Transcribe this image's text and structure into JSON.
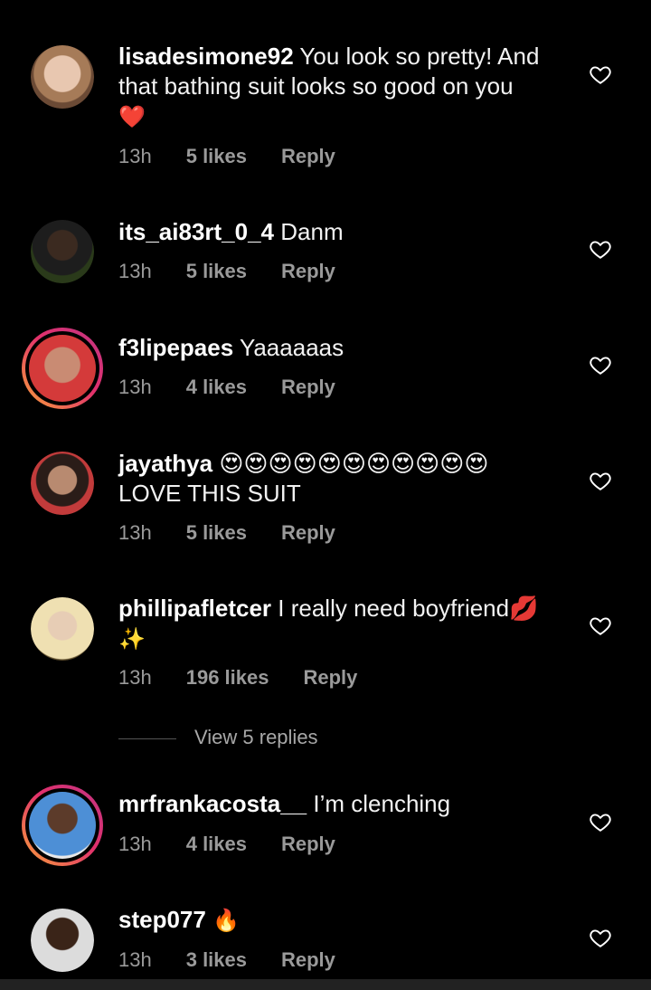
{
  "colors": {
    "background": "#000000",
    "meta": "#9a9a9a",
    "heart_icon": "#ffffff"
  },
  "comments": [
    {
      "username": "lisadesimone92",
      "text": "You look so pretty! And that bathing suit looks so good on you",
      "emoji": "❤️",
      "time": "13h",
      "likes": "5 likes",
      "reply": "Reply"
    },
    {
      "username": "its_ai83rt_0_4",
      "text": "Danm",
      "emoji": "",
      "time": "13h",
      "likes": "5 likes",
      "reply": "Reply"
    },
    {
      "username": "f3lipepaes",
      "text": "Yaaaaaas",
      "emoji": "",
      "time": "13h",
      "likes": "4 likes",
      "reply": "Reply"
    },
    {
      "username": "jayathya",
      "text": "😍😍😍😍😍😍😍😍😍😍😍",
      "emoji": "",
      "text2": "LOVE THIS SUIT",
      "time": "13h",
      "likes": "5 likes",
      "reply": "Reply"
    },
    {
      "username": "phillipafletcer",
      "text": "I really need boyfriend💋",
      "emoji": "✨",
      "time": "13h",
      "likes": "196 likes",
      "reply": "Reply"
    },
    {
      "username": "mrfrankacosta__",
      "text": "I’m clenching",
      "emoji": "",
      "time": "13h",
      "likes": "4 likes",
      "reply": "Reply"
    },
    {
      "username": "step077",
      "text": "",
      "emoji": "🔥",
      "time": "13h",
      "likes": "3 likes",
      "reply": "Reply"
    }
  ],
  "view_replies": "View 5 replies"
}
